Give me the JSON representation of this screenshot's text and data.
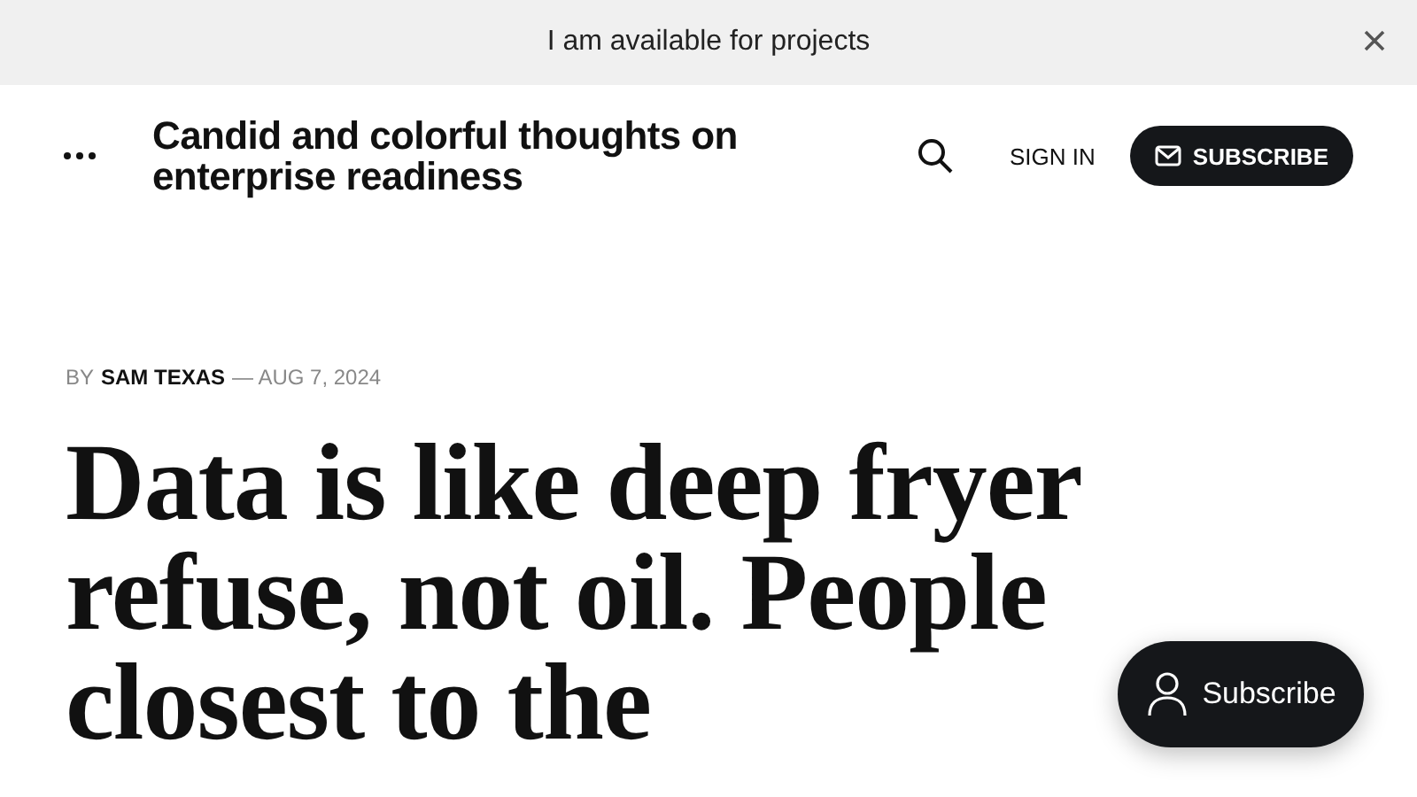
{
  "announcement_bar": {
    "text": "I am available for projects"
  },
  "header": {
    "site_title": "Candid and colorful thoughts on enterprise readiness",
    "sign_in": "SIGN IN",
    "subscribe": "SUBSCRIBE"
  },
  "article": {
    "byline_prefix": "BY",
    "author": "SAM TEXAS",
    "date": "— AUG 7, 2024",
    "title": "Data is like deep fryer refuse, not oil. People closest to the"
  },
  "floating_button": {
    "label": "Subscribe"
  }
}
